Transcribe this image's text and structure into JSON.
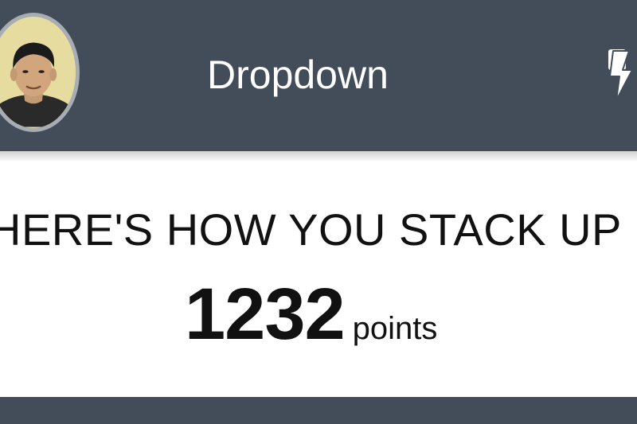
{
  "navbar": {
    "title": "Dropdown",
    "avatar_icon": "user-avatar",
    "action_icon": "lightning-bolt-icon"
  },
  "stats": {
    "headline": "HERE'S HOW YOU STACK UP",
    "score": "1232",
    "score_unit": "points"
  },
  "colors": {
    "navbar_bg": "#424d59",
    "text_primary": "#111111",
    "nav_text": "#ffffff"
  }
}
